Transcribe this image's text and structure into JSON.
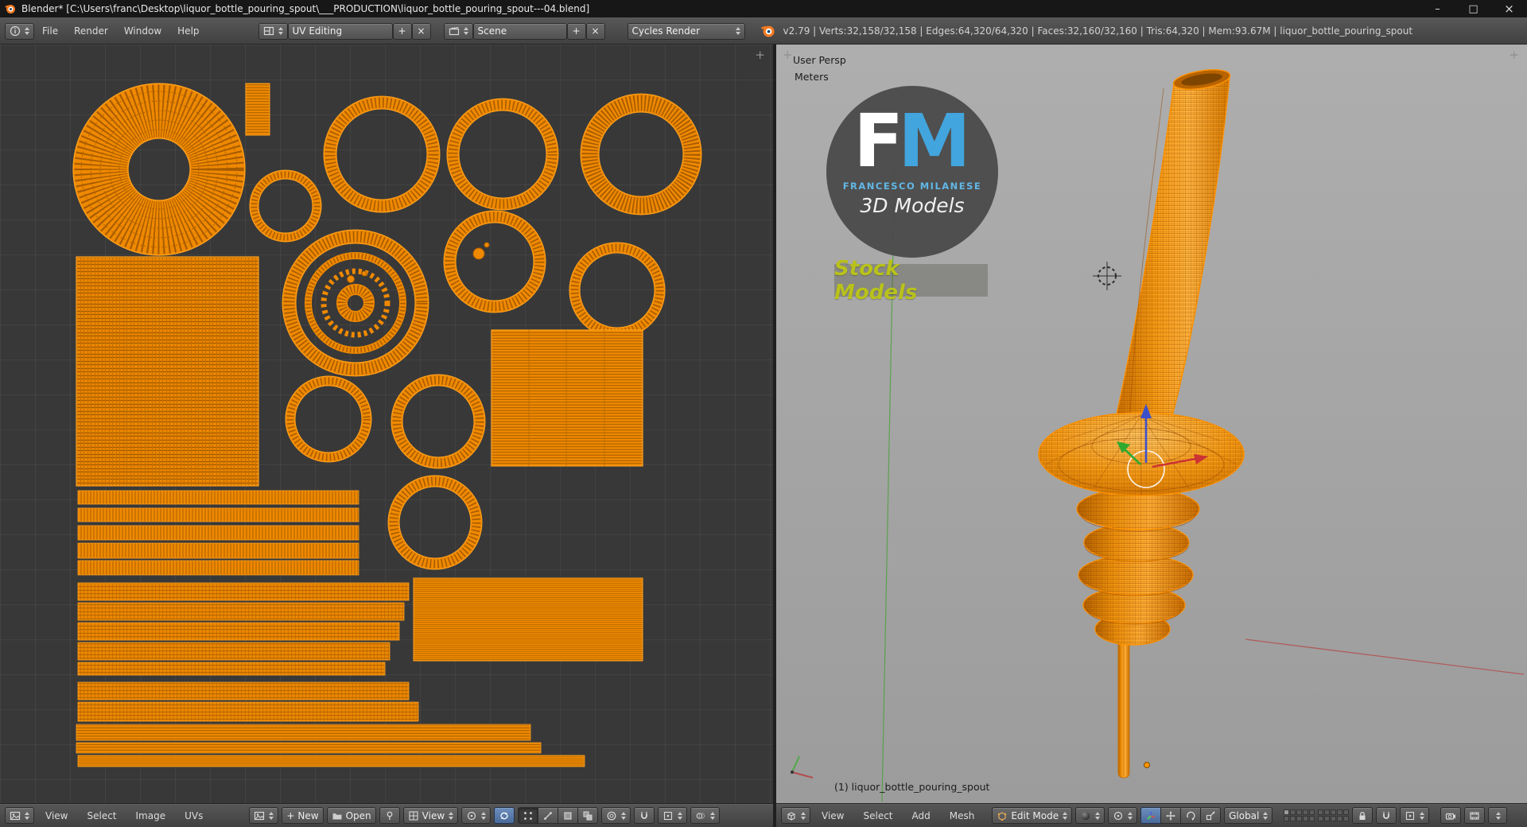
{
  "window": {
    "title": "Blender* [C:\\Users\\franc\\Desktop\\liquor_bottle_pouring_spout\\___PRODUCTION\\liquor_bottle_pouring_spout---04.blend]",
    "controls": {
      "minimize": "–",
      "maximize": "□",
      "close": "×"
    }
  },
  "icons": {
    "plus": "+",
    "close": "×"
  },
  "topbar": {
    "menus": [
      "File",
      "Render",
      "Window",
      "Help"
    ],
    "layout_value": "UV Editing",
    "scene_value": "Scene",
    "engine_value": "Cycles Render",
    "stats": "v2.79 | Verts:32,158/32,158 | Edges:64,320/64,320 | Faces:32,160/32,160 | Tris:64,320 | Mem:93.67M | liquor_bottle_pouring_spout"
  },
  "uv_editor": {
    "header": {
      "menus": [
        "View",
        "Select",
        "Image",
        "UVs"
      ],
      "new_button": "New",
      "open_button": "Open",
      "mode_value": "View"
    }
  },
  "viewport": {
    "overlay": {
      "view_name": "User Persp",
      "units": "Meters",
      "object_info": "(1) liquor_bottle_pouring_spout"
    },
    "watermark": {
      "letter_f": "F",
      "letter_m": "M",
      "brand": "FRANCESCO MILANESE",
      "brand_sub": "3D Models",
      "stock": "Stock Models"
    },
    "header": {
      "menus": [
        "View",
        "Select",
        "Add",
        "Mesh"
      ],
      "mode_value": "Edit Mode",
      "orientation_value": "Global"
    }
  },
  "colors": {
    "selection_orange": "#ff8a00",
    "axis_x_red": "#c45050",
    "axis_y_green": "#4faa46",
    "axis_z_blue": "#3c50cc",
    "brand_blue": "#42a5dd",
    "stock_yellow": "#b9c21a"
  }
}
